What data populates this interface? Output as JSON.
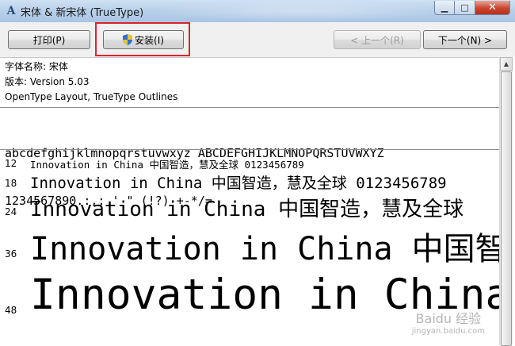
{
  "window": {
    "title": "宋体 & 新宋体 (TrueType)",
    "icon": "font-viewer-icon"
  },
  "toolbar": {
    "print_label": "打印(P)",
    "install_label": "安装(I)",
    "prev_label": "< 上一个(R)",
    "next_label": "下一个(N) >"
  },
  "font_info": {
    "name": "字体名称: 宋体",
    "version": "版本: Version 5.03",
    "type": "OpenType Layout, TrueType Outlines"
  },
  "charset": {
    "line1": "abcdefghijklmnopqrstuvwxyz ABCDEFGHIJKLMNOPQRSTUVWXYZ",
    "line2": "1234567890.:,; ' \" (!?) +-*/="
  },
  "samples": [
    {
      "size": "12",
      "text": "Innovation in China 中国智造，慧及全球 0123456789"
    },
    {
      "size": "18",
      "text": "Innovation in China 中国智造，慧及全球 0123456789"
    },
    {
      "size": "24",
      "text": "Innovation in China 中国智造，慧及全球"
    },
    {
      "size": "36",
      "text": "Innovation in China 中国智"
    },
    {
      "size": "48",
      "text": "Innovation in China"
    }
  ],
  "watermark": {
    "main": "Baidu 经验",
    "sub": "jingyan.baidu.com"
  },
  "colors": {
    "highlight": "#e0222a"
  }
}
